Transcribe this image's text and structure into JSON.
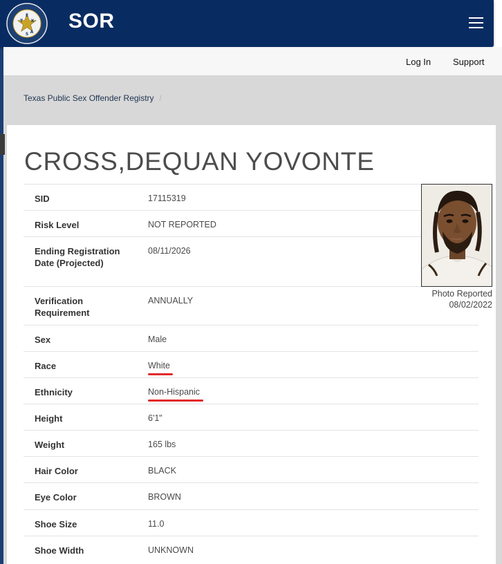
{
  "header": {
    "brand": "SOR",
    "seal": {
      "label_text": "DEPARTMENT OF PUBLIC SAFETY",
      "letters": [
        "E",
        "X",
        "T",
        "A",
        "S"
      ],
      "icon": "star-seal-icon",
      "colors": {
        "ring": "#1c3f74",
        "inner": "#f2f2f2",
        "star": "#c9a227"
      }
    },
    "menu_icon": "hamburger-menu-icon",
    "color": "#082c62"
  },
  "nav": {
    "login_label": "Log In",
    "support_label": "Support"
  },
  "breadcrumb": {
    "item": "Texas Public Sex Offender Registry",
    "separator": "/"
  },
  "offender": {
    "name": "CROSS,DEQUAN YOVONTE",
    "photo_caption_line1": "Photo Reported",
    "photo_caption_line2": "08/02/2022",
    "fields": [
      {
        "label": "SID",
        "value": "17115319"
      },
      {
        "label": "Risk Level",
        "value": "NOT REPORTED"
      },
      {
        "label": "Ending Registration Date (Projected)",
        "value": "08/11/2026"
      },
      {
        "label": "Verification Requirement",
        "value": "ANNUALLY"
      },
      {
        "label": "Sex",
        "value": "Male"
      },
      {
        "label": "Race",
        "value": "White"
      },
      {
        "label": "Ethnicity",
        "value": "Non-Hispanic"
      },
      {
        "label": "Height",
        "value": "6'1\""
      },
      {
        "label": "Weight",
        "value": "165 lbs"
      },
      {
        "label": "Hair Color",
        "value": "BLACK"
      },
      {
        "label": "Eye Color",
        "value": "BROWN"
      },
      {
        "label": "Shoe Size",
        "value": "11.0"
      },
      {
        "label": "Shoe Width",
        "value": "UNKNOWN"
      }
    ]
  },
  "annotations": {
    "underline_color": "#e2292a",
    "underlined_fields": [
      "Race",
      "Ethnicity"
    ]
  }
}
